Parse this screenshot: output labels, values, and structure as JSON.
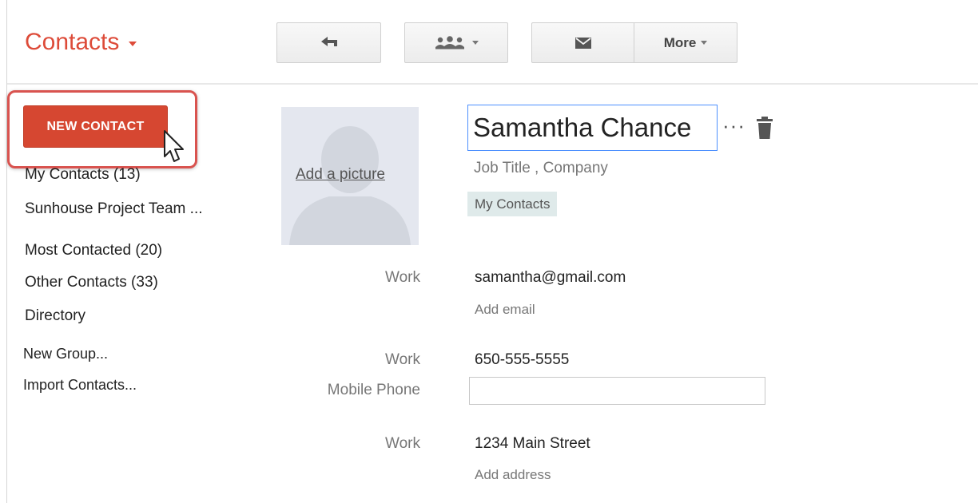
{
  "header": {
    "title": "Contacts",
    "more_label": "More"
  },
  "icons": {
    "back": "reply-arrow-icon",
    "group": "people-group-icon",
    "mail": "envelope-icon",
    "trash": "trash-icon"
  },
  "sidebar": {
    "new_contact_label": "NEW CONTACT",
    "items": [
      {
        "label": "My Contacts (13)"
      },
      {
        "label": "Sunhouse Project Team ..."
      },
      {
        "label": "Most Contacted (20)"
      },
      {
        "label": "Other Contacts (33)"
      },
      {
        "label": "Directory"
      },
      {
        "label": "New Group..."
      },
      {
        "label": "Import Contacts..."
      }
    ]
  },
  "contact": {
    "add_picture": "Add a picture",
    "name": "Samantha Chance",
    "more_dots": "···",
    "job_title": "Job Title",
    "company": "Company",
    "group_chip": "My Contacts",
    "email": {
      "label": "Work",
      "value": "samantha@gmail.com",
      "add": "Add email"
    },
    "phone": {
      "label": "Work",
      "value": "650-555-5555",
      "mobile_label": "Mobile Phone",
      "mobile_value": ""
    },
    "address": {
      "label": "Work",
      "value": "1234 Main Street",
      "add": "Add address"
    }
  },
  "colors": {
    "accent_red": "#dd4b39",
    "button_red": "#d64731",
    "focus_blue": "#4d90fe"
  }
}
